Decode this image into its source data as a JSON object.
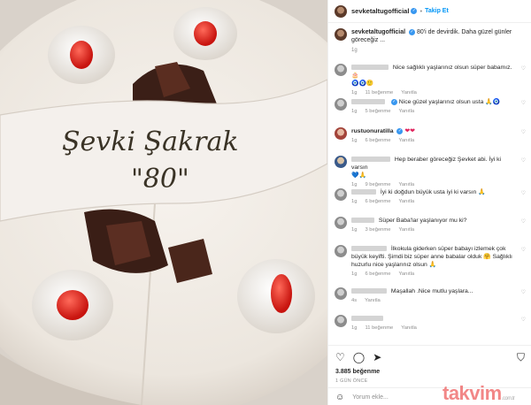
{
  "post": {
    "username": "sevketaltugofficial",
    "follow_label": "Takip Et",
    "caption": "80'i de devirdik. Daha güzel günler göreceğiz ...",
    "caption_age": "1g",
    "likes": "3.885 beğenme",
    "date": "1 GÜN ÖNCE",
    "add_comment_placeholder": "Yorum ekle...",
    "cake_text_line1": "Şevki Şakrak",
    "cake_text_line2": "\"80\"",
    "icons": [
      "heart-icon",
      "comment-icon",
      "share-icon",
      "save-icon",
      "emoji-icon",
      "verified-badge-icon"
    ]
  },
  "comments": [
    {
      "user": "",
      "text": "Nice sağlıklı yaşlarınız olsun süper babamız.",
      "emoji": "🎂",
      "extra": "🧿🧿🙂",
      "age": "1g",
      "likes": "11 beğenme",
      "reply": "Yanıtla"
    },
    {
      "user": "",
      "text": "Nice güzel yaşlarınız olsun usta",
      "emoji": "🙏🧿",
      "extra": "",
      "age": "1g",
      "likes": "5 beğenme",
      "reply": "Yanıtla"
    },
    {
      "user": "rustuonuratilla",
      "text": "",
      "emoji": "❤❤",
      "extra": "",
      "age": "1g",
      "likes": "6 beğenme",
      "reply": "Yanıtla"
    },
    {
      "user": "",
      "text": "Hep beraber göreceğiz Şevket abi. İyi ki varsın",
      "emoji": "",
      "extra": "💙🙏",
      "age": "1g",
      "likes": "9 beğenme",
      "reply": "Yanıtla"
    },
    {
      "user": "",
      "text": "İyi ki doğdun büyük usta iyi ki varsın",
      "emoji": "🙏",
      "extra": "",
      "age": "1g",
      "likes": "6 beğenme",
      "reply": "Yanıtla"
    },
    {
      "user": "",
      "text": "Süper Baba'lar yaşlanıyor mu ki?",
      "emoji": "",
      "extra": "",
      "age": "1g",
      "likes": "3 beğenme",
      "reply": "Yanıtla"
    },
    {
      "user": "",
      "text": "İlkokula giderken süper babayı izlemek çok büyük keyifti. Şimdi biz süper anne babalar olduk",
      "emoji": "🤗",
      "extra": "Sağlıklı huzurlu nice yaşlarınız olsun 🙏",
      "age": "1g",
      "likes": "6 beğenme",
      "reply": "Yanıtla"
    },
    {
      "user": "",
      "text": "Maşallah .Nice mutlu yaşlara...",
      "emoji": "",
      "extra": "",
      "age": "4s",
      "likes": "",
      "reply": "Yanıtla"
    },
    {
      "user": "",
      "text": "",
      "emoji": "",
      "extra": "",
      "age": "1g",
      "likes": "11 beğenme",
      "reply": "Yanıtla"
    }
  ],
  "watermark": {
    "brand": "takvim",
    "suffix": ".com.tr"
  }
}
